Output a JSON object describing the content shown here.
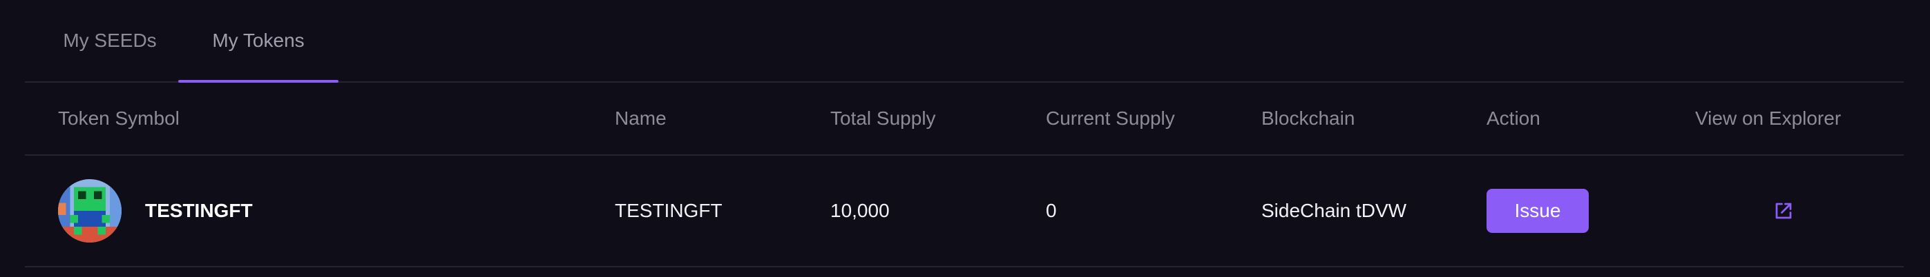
{
  "tabs": [
    {
      "label": "My SEEDs",
      "active": false
    },
    {
      "label": "My Tokens",
      "active": true
    }
  ],
  "table": {
    "headers": {
      "symbol": "Token Symbol",
      "name": "Name",
      "total_supply": "Total Supply",
      "current_supply": "Current Supply",
      "blockchain": "Blockchain",
      "action": "Action",
      "explorer": "View on Explorer"
    },
    "rows": [
      {
        "symbol": "TESTINGFT",
        "name": "TESTINGFT",
        "total_supply": "10,000",
        "current_supply": "0",
        "blockchain": "SideChain tDVW",
        "action_label": "Issue",
        "avatar_icon": "pixel-art-avatar",
        "explorer_icon": "external-link-icon"
      }
    ]
  },
  "colors": {
    "background": "#0f0d17",
    "accent": "#8b5cf6",
    "muted_text": "#8e8c99",
    "divider": "#26242e"
  }
}
